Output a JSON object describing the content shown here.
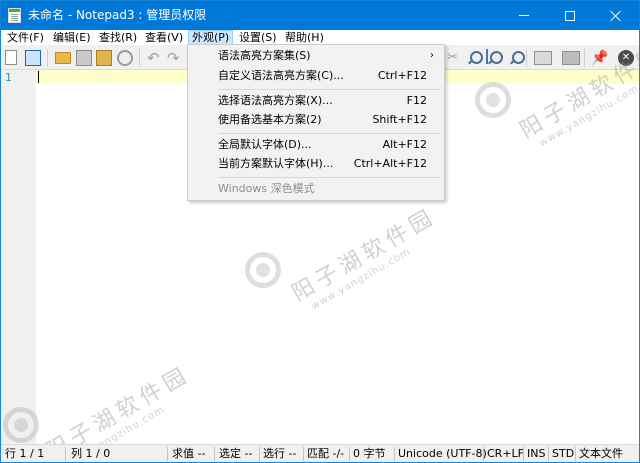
{
  "window": {
    "title": "未命名 - Notepad3 : 管理员权限",
    "accent": "#0078d7"
  },
  "menubar": {
    "items": [
      {
        "label": "文件(F)"
      },
      {
        "label": "编辑(E)"
      },
      {
        "label": "查找(R)"
      },
      {
        "label": "查看(V)"
      },
      {
        "label": "外观(P)",
        "active": true
      },
      {
        "label": "设置(S)"
      },
      {
        "label": "帮助(H)"
      }
    ]
  },
  "toolbar": {
    "icons": [
      "new-icon",
      "open-tabs-icon",
      "folder-icon",
      "save-icon",
      "save-as-icon",
      "print-icon",
      "undo-icon",
      "redo-icon",
      "cut-icon",
      "zoom-in-icon",
      "zoom-reset-icon",
      "zoom-out-icon",
      "scheme-icon",
      "word-wrap-icon",
      "pin-icon",
      "exit-icon"
    ]
  },
  "editor": {
    "line_number": "1",
    "current_line_color": "#ffffcc"
  },
  "dropdown": {
    "items": [
      {
        "label": "语法高亮方案集(S)",
        "accel": "",
        "submenu": true
      },
      {
        "label": "自定义语法高亮方案(C)...",
        "accel": "Ctrl+F12"
      },
      {
        "label": "选择语法高亮方案(X)...",
        "accel": "F12"
      },
      {
        "label": "使用备选基本方案(2)",
        "accel": "Shift+F12"
      },
      {
        "label": "全局默认字体(D)...",
        "accel": "Alt+F12"
      },
      {
        "label": "当前方案默认字体(H)...",
        "accel": "Ctrl+Alt+F12"
      },
      {
        "label": "Windows 深色模式",
        "accel": "",
        "disabled": true
      }
    ]
  },
  "watermark": {
    "title": "阳子湖软件园",
    "url": "www.yangzihu.com"
  },
  "statusbar": {
    "line": "行 1 / 1",
    "col": "列 1 / 0",
    "value": "求值 --",
    "selection": "选定 --",
    "sel_lines": "选行 --",
    "match": "匹配 -/-",
    "bytes": "0 字节",
    "encoding": "Unicode (UTF-8)",
    "eol": "CR+LF",
    "ins": "INS",
    "std": "STD",
    "lexer": "文本文件"
  }
}
